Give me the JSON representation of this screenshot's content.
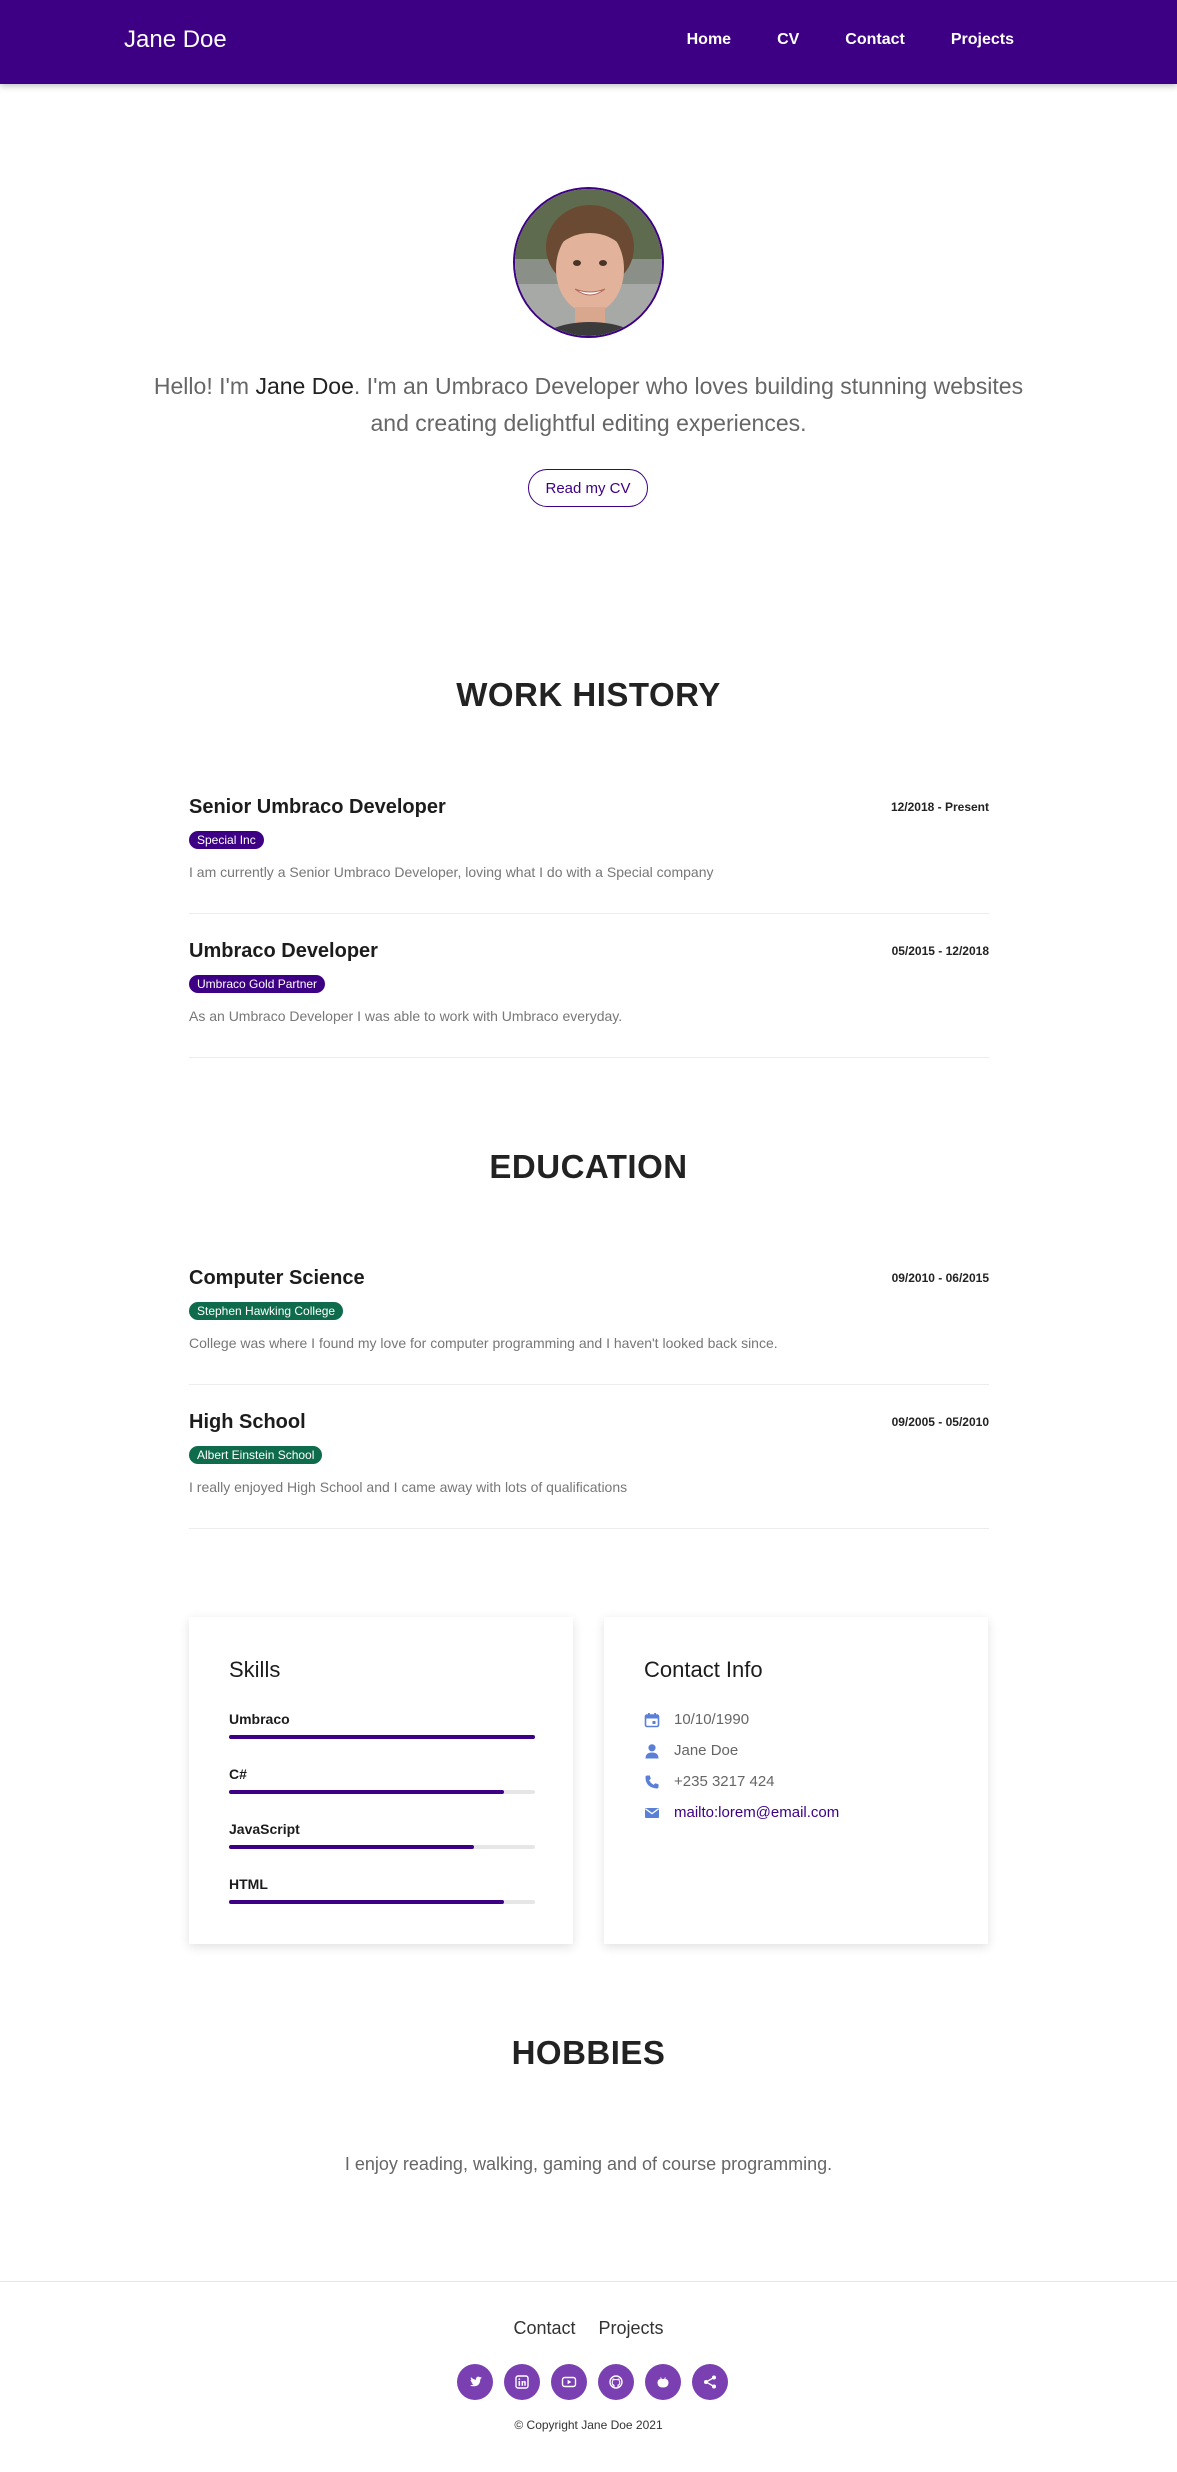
{
  "nav": {
    "brand": "Jane Doe",
    "links": [
      "Home",
      "CV",
      "Contact",
      "Projects"
    ]
  },
  "hero": {
    "intro_prefix": "Hello! I'm ",
    "intro_name": "Jane Doe",
    "intro_suffix": ". I'm an Umbraco Developer who loves building stunning websites and creating delightful editing experiences.",
    "cv_button": "Read my CV"
  },
  "work": {
    "title": "WORK HISTORY",
    "items": [
      {
        "title": "Senior Umbraco Developer",
        "date": "12/2018 - Present",
        "company": "Special Inc",
        "description": "I am currently a Senior Umbraco Developer, loving what I do with a Special company"
      },
      {
        "title": "Umbraco Developer",
        "date": "05/2015 - 12/2018",
        "company": "Umbraco Gold Partner",
        "description": "As an Umbraco Developer I was able to work with Umbraco everyday."
      }
    ]
  },
  "education": {
    "title": "EDUCATION",
    "items": [
      {
        "title": "Computer Science",
        "date": "09/2010 - 06/2015",
        "school": "Stephen Hawking College",
        "description": "College was where I found my love for computer programming and I haven't looked back since."
      },
      {
        "title": "High School",
        "date": "09/2005 - 05/2010",
        "school": "Albert Einstein School",
        "description": "I really enjoyed High School and I came away with lots of qualifications"
      }
    ]
  },
  "skills": {
    "title": "Skills",
    "items": [
      {
        "name": "Umbraco",
        "level": 100
      },
      {
        "name": "C#",
        "level": 90
      },
      {
        "name": "JavaScript",
        "level": 80
      },
      {
        "name": "HTML",
        "level": 90
      }
    ]
  },
  "contact": {
    "title": "Contact Info",
    "birthday": "10/10/1990",
    "name": "Jane Doe",
    "phone": "+235 3217 424",
    "email": "mailto:lorem@email.com"
  },
  "hobbies": {
    "title": "HOBBIES",
    "text": "I enjoy reading, walking, gaming and of course programming."
  },
  "footer": {
    "links": [
      "Contact",
      "Projects"
    ],
    "socials": [
      "twitter-icon",
      "linkedin-icon",
      "youtube-icon",
      "github-icon",
      "umbraco-icon",
      "share-icon"
    ],
    "copyright": "© Copyright Jane Doe 2021"
  },
  "colors": {
    "primary": "#3d0085",
    "education_badge": "#0e6b4c",
    "social_bg": "#7a3fb0"
  }
}
